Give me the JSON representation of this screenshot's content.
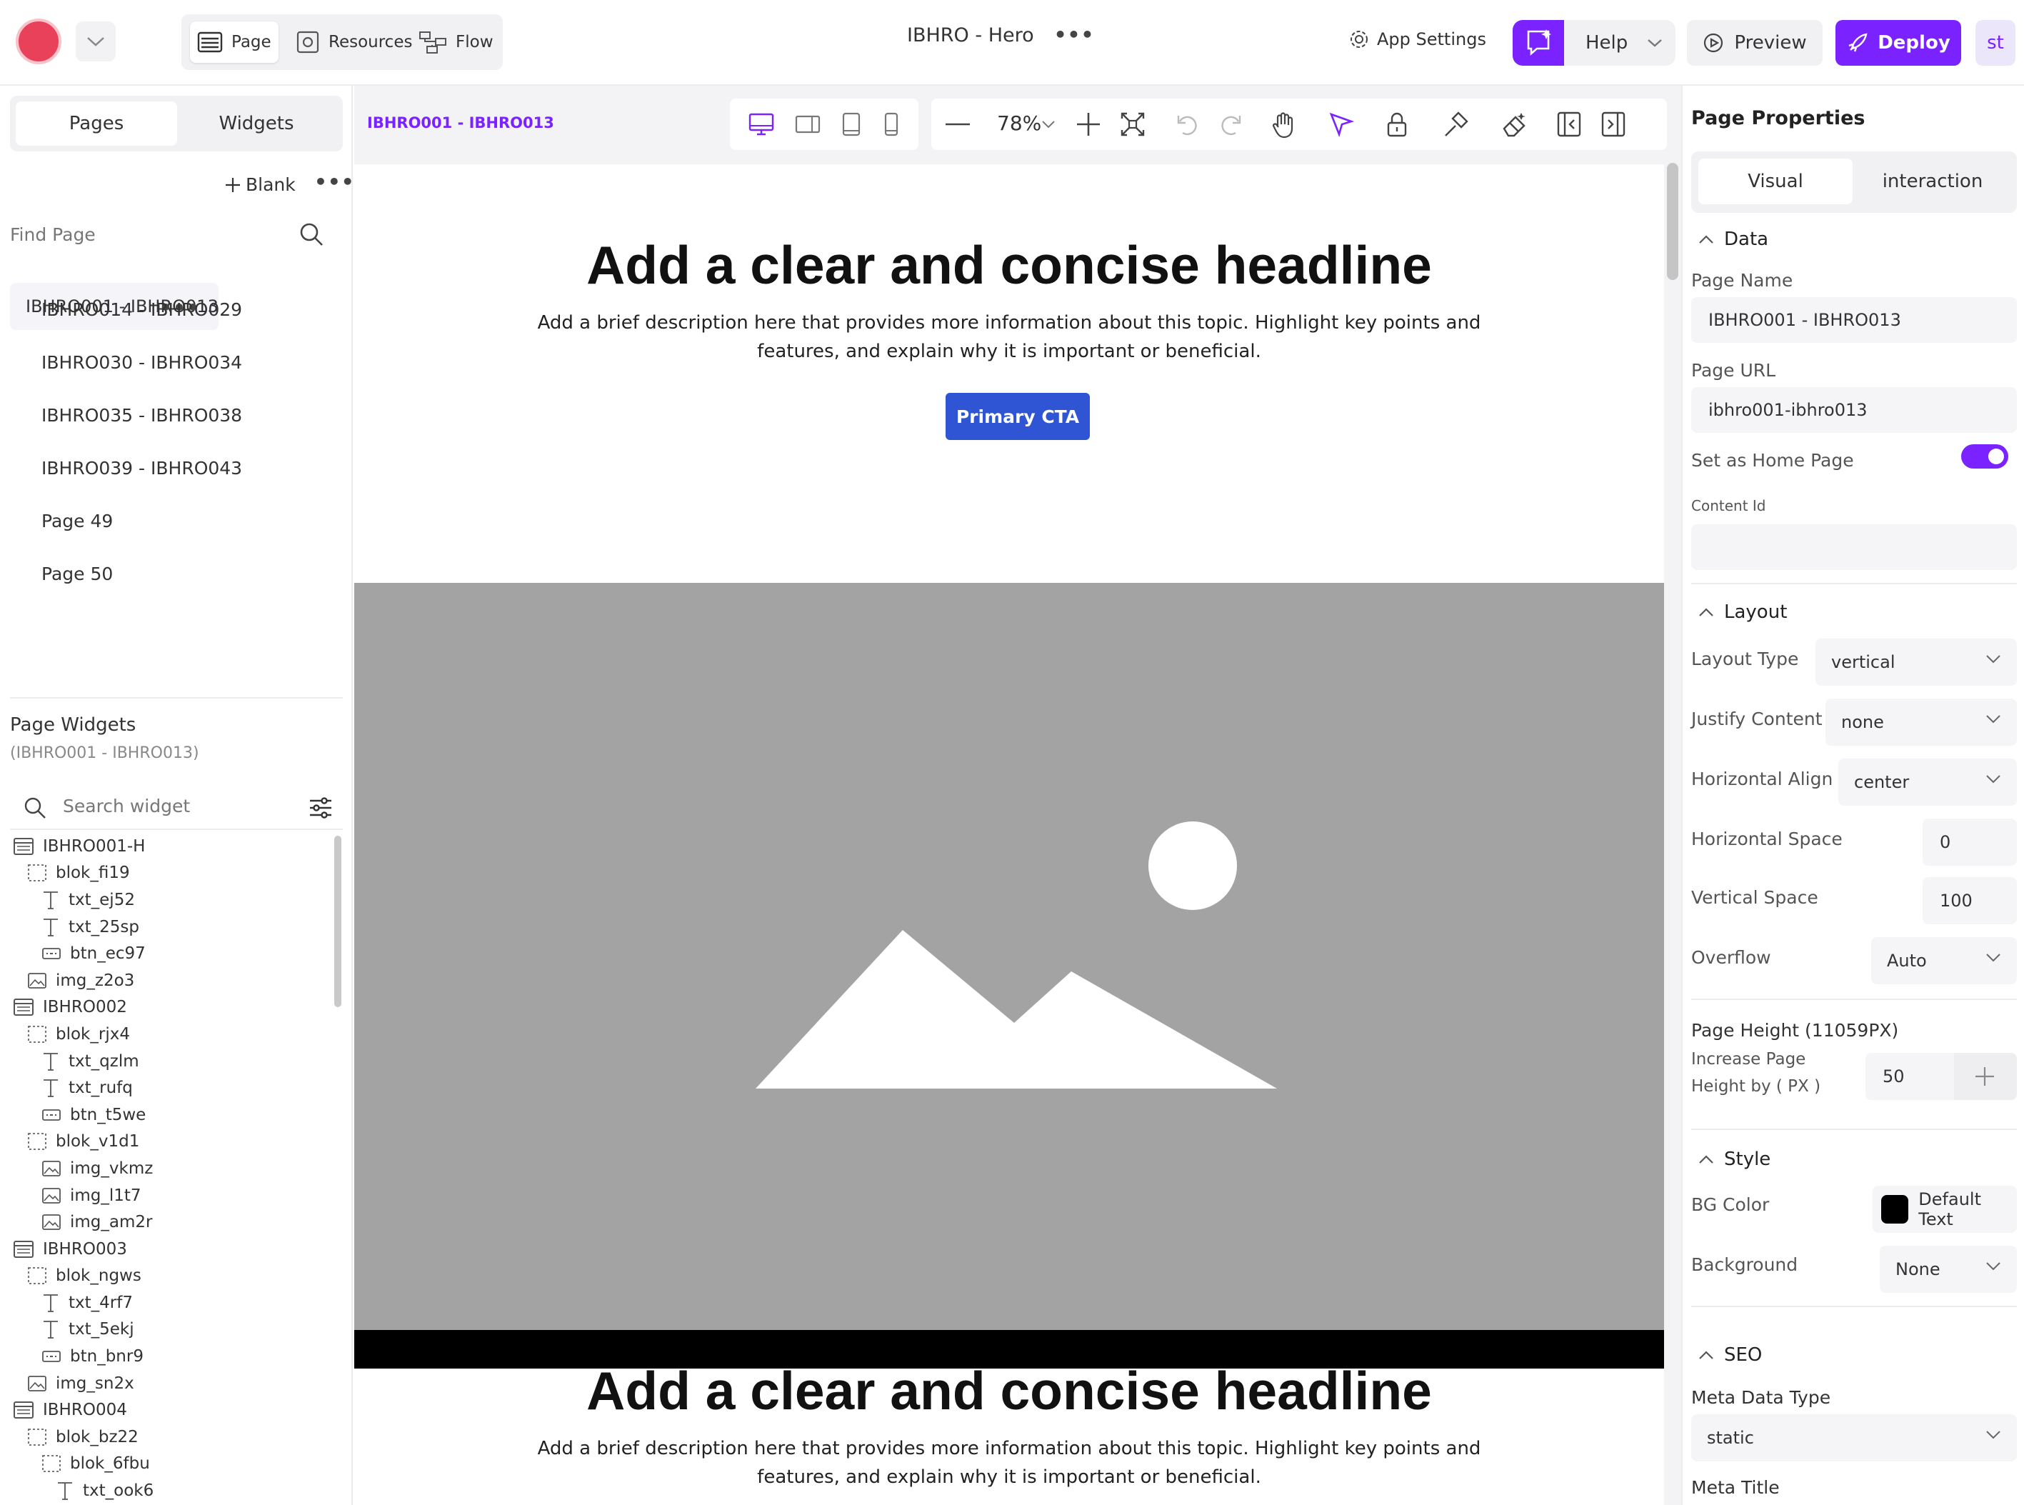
{
  "topbar": {
    "modes": [
      {
        "label": "Page"
      },
      {
        "label": "Resources"
      },
      {
        "label": "Flow"
      }
    ],
    "title": "IBHRO - Hero",
    "more": "•••",
    "app_settings": "App Settings",
    "help": "Help",
    "preview": "Preview",
    "deploy": "Deploy",
    "avatar": "st",
    "accent": "#7a22ff"
  },
  "left": {
    "tabs": [
      "Pages",
      "Widgets"
    ],
    "blank": "Blank",
    "more": "•••",
    "find_page": "Find Page",
    "pages": [
      {
        "label": "IBHRO001 - IBHRO013",
        "selected": true
      },
      {
        "label": "IBHRO014 - IBHRO029"
      },
      {
        "label": "IBHRO030 - IBHRO034"
      },
      {
        "label": "IBHRO035 - IBHRO038"
      },
      {
        "label": "IBHRO039 - IBHRO043"
      },
      {
        "label": "Page 49"
      },
      {
        "label": "Page 50"
      }
    ],
    "widgets_title": "Page Widgets",
    "widgets_sub": "(IBHRO001 - IBHRO013)",
    "search_widget": "Search widget",
    "tree": [
      {
        "label": "IBHRO001-H",
        "type": "section",
        "depth": 0
      },
      {
        "label": "blok_fi19",
        "type": "block",
        "depth": 1
      },
      {
        "label": "txt_ej52",
        "type": "text",
        "depth": 2
      },
      {
        "label": "txt_25sp",
        "type": "text",
        "depth": 2
      },
      {
        "label": "btn_ec97",
        "type": "button",
        "depth": 2
      },
      {
        "label": "img_z2o3",
        "type": "image",
        "depth": 1
      },
      {
        "label": "IBHRO002",
        "type": "section",
        "depth": 0
      },
      {
        "label": "blok_rjx4",
        "type": "block",
        "depth": 1
      },
      {
        "label": "txt_qzlm",
        "type": "text",
        "depth": 2
      },
      {
        "label": "txt_rufq",
        "type": "text",
        "depth": 2
      },
      {
        "label": "btn_t5we",
        "type": "button",
        "depth": 2
      },
      {
        "label": "blok_v1d1",
        "type": "block",
        "depth": 1
      },
      {
        "label": "img_vkmz",
        "type": "image",
        "depth": 2
      },
      {
        "label": "img_l1t7",
        "type": "image",
        "depth": 2
      },
      {
        "label": "img_am2r",
        "type": "image",
        "depth": 2
      },
      {
        "label": "IBHRO003",
        "type": "section",
        "depth": 0
      },
      {
        "label": "blok_ngws",
        "type": "block",
        "depth": 1
      },
      {
        "label": "txt_4rf7",
        "type": "text",
        "depth": 2
      },
      {
        "label": "txt_5ekj",
        "type": "text",
        "depth": 2
      },
      {
        "label": "btn_bnr9",
        "type": "button",
        "depth": 2
      },
      {
        "label": "img_sn2x",
        "type": "image",
        "depth": 1
      },
      {
        "label": "IBHRO004",
        "type": "section",
        "depth": 0
      },
      {
        "label": "blok_bz22",
        "type": "block",
        "depth": 1
      },
      {
        "label": "blok_6fbu",
        "type": "block",
        "depth": 2
      },
      {
        "label": "txt_ook6",
        "type": "text",
        "depth": 3
      }
    ]
  },
  "canvas": {
    "breadcrumb": "IBHRO001 - IBHRO013",
    "zoom": "78%",
    "headline": "Add a clear and concise headline",
    "description": "Add a brief description here that provides more information about this topic. Highlight key points and features, and explain why it is important or beneficial.",
    "cta": "Primary CTA",
    "headline2": "Add a clear and concise headline",
    "description2": "Add a brief description here that provides more information about this topic. Highlight key points and features, and explain why it is important or beneficial.",
    "cta_color": "#2f55d4"
  },
  "right": {
    "title": "Page Properties",
    "tabs": [
      "Visual",
      "interaction"
    ],
    "data_section": "Data",
    "page_name_label": "Page Name",
    "page_name": "IBHRO001 - IBHRO013",
    "page_url_label": "Page URL",
    "page_url": "ibhro001-ibhro013",
    "home_label": "Set as Home Page",
    "home_on": true,
    "content_id_label": "Content Id",
    "content_id": "",
    "layout_section": "Layout",
    "layout_type_label": "Layout Type",
    "layout_type": "vertical",
    "justify_label": "Justify Content",
    "justify": "none",
    "halign_label": "Horizontal Align",
    "halign": "center",
    "hspace_label": "Horizontal Space",
    "hspace": "0",
    "vspace_label": "Vertical Space",
    "vspace": "100",
    "overflow_label": "Overflow",
    "overflow": "Auto",
    "page_height": "Page Height (11059PX)",
    "increase_label_1": "Increase Page",
    "increase_label_2": "Height by ( PX )",
    "increase_value": "50",
    "style_section": "Style",
    "bg_color_label": "BG Color",
    "bg_color": "Default Text",
    "background_label": "Background",
    "background": "None",
    "seo_section": "SEO",
    "meta_type_label": "Meta Data Type",
    "meta_type": "static",
    "meta_title_label": "Meta Title"
  }
}
